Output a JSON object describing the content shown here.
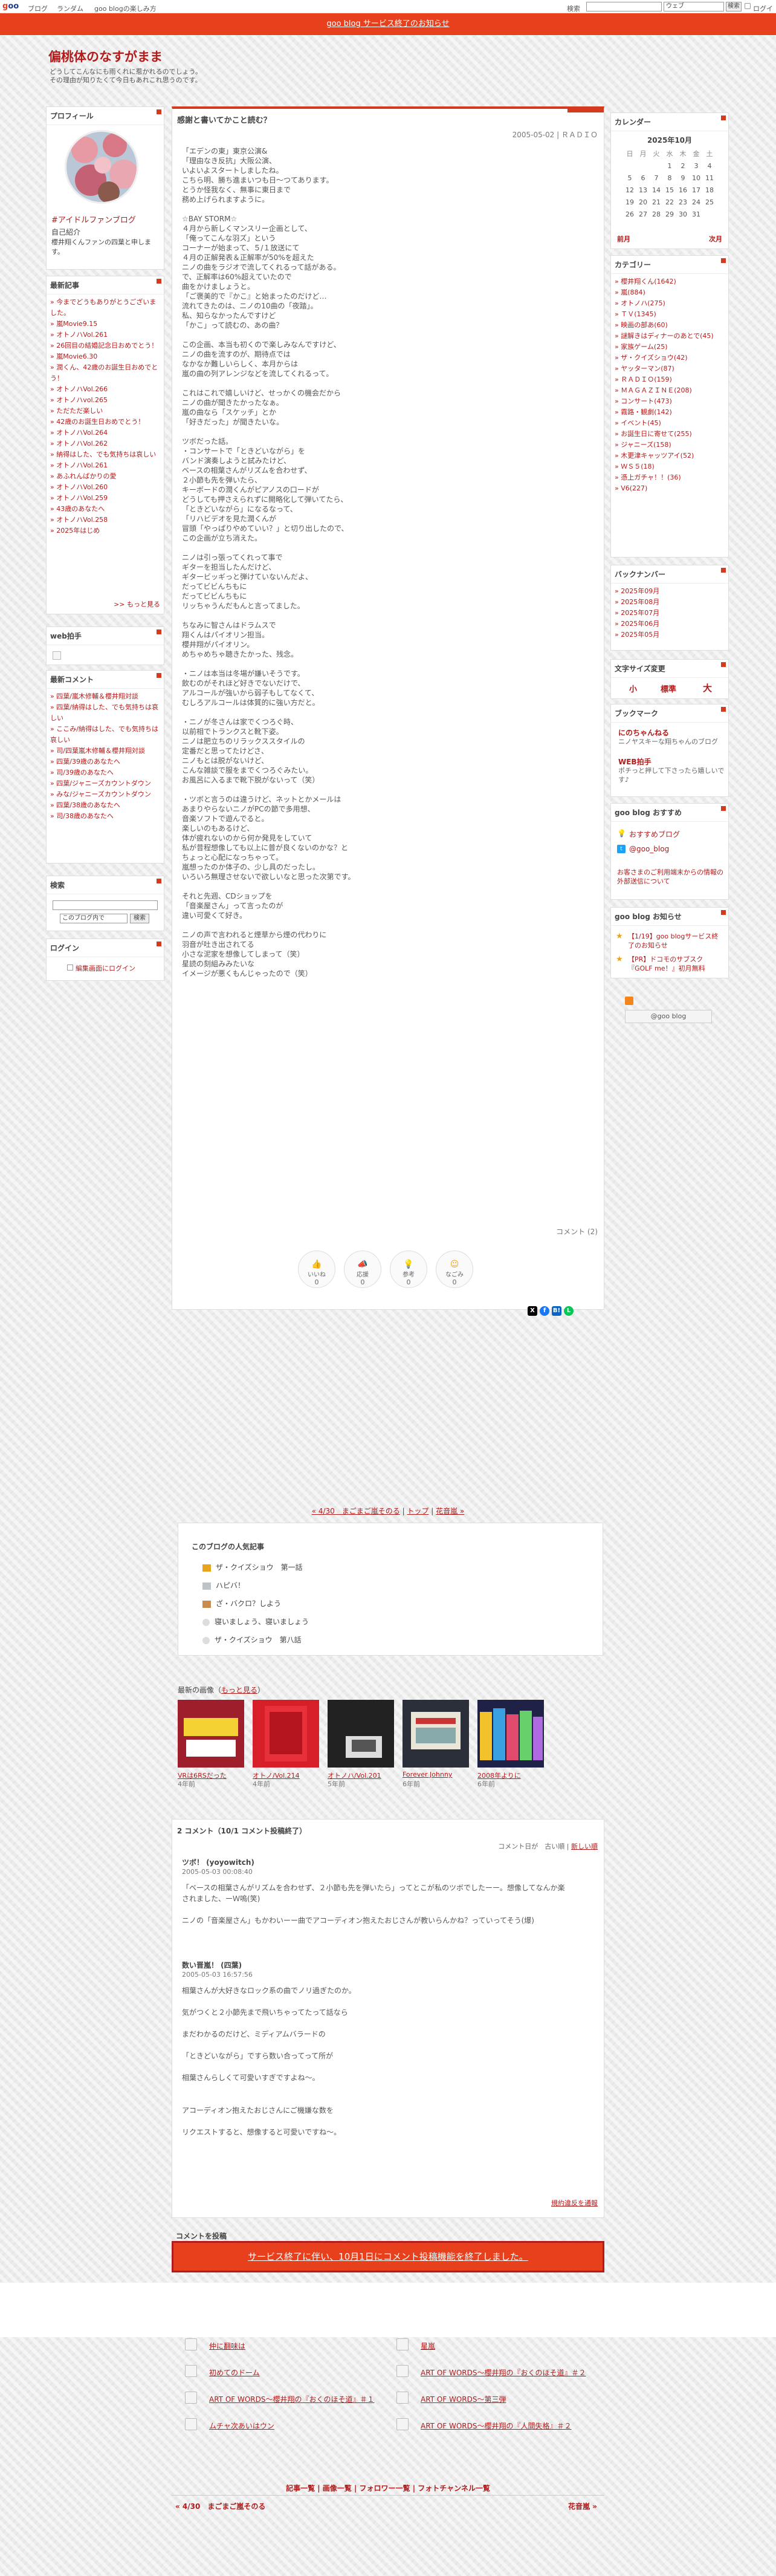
{
  "topbar": {
    "logo": "goo",
    "links": [
      "ブログ",
      "ランダム",
      "goo blogの楽しみ方"
    ],
    "search_label": "検索",
    "search_select": "ウェブ",
    "search_button": "検索",
    "login": "ログイン"
  },
  "notice": {
    "text": "goo blog サービス終了のお知らせ"
  },
  "header": {
    "title": "偏桃体のなすがまま",
    "desc1": "どうしてこんなにも雨くれに惹かれるのでしょう。",
    "desc2": "その理由が知りたくて今日もあれこれ思うのです。"
  },
  "profile": {
    "title": "プロフィール",
    "tag": "#アイドルファンブログ",
    "self_intro_heading": "自己紹介",
    "self_intro": "櫻井翔くんファンの四葉と申します。"
  },
  "recent_posts": {
    "title": "最新記事",
    "items": [
      "今までどうもありがとうございました。",
      "嵐Movie9.15",
      "オトノハVol.261",
      "26回目の結婚記念日おめでとう！",
      "嵐Movie6.30",
      "潤くん、42歳のお誕生日おめでとう！",
      "オトノハVol.266",
      "オトノハvol.265",
      "ただただ楽しい",
      "42歳のお誕生日おめでとう！",
      "オトノハVol.264",
      "オトノハVol.262",
      "納得はした、でも気持ちは哀しい",
      "オトノハVol.261",
      "あふれんばかりの愛",
      "オトノハVol.260",
      "オトノハVol.259",
      "43歳のあなたへ",
      "オトノハVol.258",
      "2025年はじめ"
    ],
    "more": ">> もっと見る"
  },
  "web_helper": {
    "title": "web拍手"
  },
  "recent_comments": {
    "title": "最新コメント",
    "items": [
      "四葉/嵐木修輔＆櫻井翔対談",
      "四葉/納得はした、でも気持ちは哀しい",
      "ここみ/納得はした、でも気持ちは哀しい",
      "司/四葉嵐木修輔＆櫻井翔対談",
      "四葉/39歳のあなたへ",
      "司/39歳のあなたへ",
      "四葉/ジャニーズカウントダウン",
      "みな/ジャニーズカウントダウン",
      "四葉/38歳のあなたへ",
      "司/38歳のあなたへ"
    ]
  },
  "search_widget": {
    "title": "検索",
    "select": "このブログ内で",
    "button": "検索"
  },
  "login_widget": {
    "title": "ログイン",
    "link": "編集画面にログイン"
  },
  "post": {
    "title": "感謝と書いてかこと読む？",
    "date": "2005-05-02 | ＲＡＤＩＯ",
    "body": "「エデンの東」東京公演&\n「理由なき反抗」大阪公演、\nいよいよスタートしましたね。\nこちら明、勝ち進まいつも日～つてあります。\nとうか怪我なく、無事に東日まで\n務め上げられますように。\n\n☆BAY STORM☆\n４月から新しくマンスリー企画として、\n「俺ってこんな羽ズ」という\nコーナーが始まって、５/１放送にて\n４月の正解発表＆正解率が50%を超えた\nニノの曲をラジオで流してくれるって話がある。\nで、正解率は60%超えていたので\n曲をかけましょうと。\n「ご褒美的で『かこ』と始まったのだけど…\n流れてきたのは、ニノの10曲の「夜踏」。\n私、知らなかったんですけど\n「かこ」って読むの、あの曲？\n\nこの企画、本当も初くので楽しみなんですけど、\nニノの曲を流すのが、期待点では\nなかなか難しいらしく、本月からは\n嵐の曲の列アレンジなどを流してくれるって。\n\nこれはこれで嬉しいけど、せっかくの機会だから\nニノの曲が聞きたかったなぁ。\n嵐の曲なら「スケッチ」とか\n「好きだった」が聞きたいな。\n\nツボだった話。\n・コンサートで「ときどいながら」を\nバンド演奏しようと試みたけど、\nベースの相葉さんがリズムを合わせず、\n２小節も先を弾いたら、\nキーボードの潤くんがピアノスの口ードが\nどうしても押さえられずに開略化して弾いてたら、\n「ときどいながら」になるなって、\n「リハビデオを見た潤くんが\n冒頭「やっぱりやめていい？」と切り出したので、\nこの企画が立ち消えた。\n\nニノは引っ張ってくれって事で\nギターを担当したんだけど、\nギタービッギっと弾けていないんだよ、\nだってビビんちもに\nだってビビんちもに\nリッちゃうんだもんと言ってました。\n\nちなみに智さんはドラムスで\n翔くんはパイオリン担当。\n櫻井翔がパイオリン。\nめちゃめちゃ聴きたかった、残念。\n\n・ニノは本当は冬場が嫌いそうです。\n飲むのがそれほど好きでないだけで、\nアルコールが強いから弱子もしてなくて、\nむしろアルコールは体質的に強い方だと。\n\n・ニノが冬さんは家でくつろぐ時、\n以前相でトランクスと靴下姿。\nニノは肥立ちのリラックススタイルの\n定番だと思ってたけどさ、\nニノもとは脱がないけど、\nこんな雑談で服をまでくつろぐみたい。\nお風呂に入るまで靴下脱がないって（笑）\n\n・ツボと言うのは違うけど、ネットとかメールは\nあまりやらないニノがPCの節で多用想、\n音楽ソフトで遊んでると。\n楽しいのもあるけど、\n体が疲れないのから何か発見をしていて\n私が昔程想像しても以上に普が良くないのかな？と\nちょっと心配になっちゃって。\n嵐想ったのか体子の、少し具のだったし。\nいろいろ無理させないで欲しいなと思った次第です。\n\nそれと先週、CDショップを\n「音楽屋さん」って言ったのが\n違い可愛くて好き。\n\nニノの声で言われると煙草から煙の代わりに\n羽音が吐き出されてる\n小さな泥家を想像してしまって（笑）\n星読の刻組みみたいな\nイメージが悪くもんじゃったので（笑）",
    "comment_count": "コメント (2)",
    "reactions": [
      {
        "label": "いいね",
        "count": "0"
      },
      {
        "label": "応援",
        "count": "0"
      },
      {
        "label": "参考",
        "count": "0"
      },
      {
        "label": "なごみ",
        "count": "0"
      }
    ]
  },
  "calendar": {
    "title": "カレンダー",
    "month": "2025年10月",
    "weekdays": [
      "日",
      "月",
      "火",
      "水",
      "木",
      "金",
      "土"
    ],
    "rows": [
      [
        "",
        "",
        "",
        "1",
        "2",
        "3",
        "4"
      ],
      [
        "5",
        "6",
        "7",
        "8",
        "9",
        "10",
        "11"
      ],
      [
        "12",
        "13",
        "14",
        "15",
        "16",
        "17",
        "18"
      ],
      [
        "19",
        "20",
        "21",
        "22",
        "23",
        "24",
        "25"
      ],
      [
        "26",
        "27",
        "28",
        "29",
        "30",
        "31",
        ""
      ]
    ],
    "prev": "前月",
    "next": "次月"
  },
  "categories": {
    "title": "カテゴリー",
    "items": [
      "櫻井翔くん(1642)",
      "嵐(884)",
      "オトノハ(275)",
      "ＴＶ(1345)",
      "映画の部あ(60)",
      "謎解きはディナーのあとで(45)",
      "家族ゲーム(25)",
      "ザ・クイズショウ(42)",
      "ヤッターマン(87)",
      "ＲＡＤＩＯ(159)",
      "ＭＡＧＡＺＩＮＥ(208)",
      "コンサート(473)",
      "霧路・観劇(142)",
      "イベント(45)",
      "お誕生日に寄せて(255)",
      "ジャニーズ(158)",
      "木更津キャッツアイ(52)",
      "ＷＳ５(18)",
      "憑上ガチャ！！(36)",
      "V6(227)"
    ]
  },
  "backnumber": {
    "title": "バックナンバー",
    "items": [
      "2025年09月",
      "2025年08月",
      "2025年07月",
      "2025年06月",
      "2025年05月"
    ]
  },
  "fontsize": {
    "title": "文字サイズ変更",
    "small": "小",
    "medium": "標準",
    "large": "大"
  },
  "bookmark": {
    "title": "ブックマーク",
    "items": [
      {
        "name": "にのちゃんねる",
        "desc": "ニノヤスキーな翔ちゃんのブログ"
      },
      {
        "name": "WEB拍手",
        "desc": "ポチっと押して下さったら嬉しいです♪"
      }
    ]
  },
  "goo_recommend": {
    "title": "goo blog おすすめ",
    "items": [
      "おすすめブログ",
      "@goo_blog"
    ],
    "notice": "お客さまのご利用端末からの情報の外部送信について"
  },
  "goo_news": {
    "title": "goo blog お知らせ",
    "items": [
      "【1/19】goo blogサービス終了のお知らせ",
      "【PR】ドコモのサブスク『GOLF me！』初月無料"
    ]
  },
  "rss": {
    "label": "@goo blog"
  },
  "pager_top": {
    "prev": "« 4/30　まごまご嵐そのる",
    "top": "トップ",
    "next": "花音嵐 »"
  },
  "popular": {
    "title": "このブログの人気記事",
    "items": [
      "ザ・クイズショウ　第一話",
      "ハピバ！",
      "ざ・バクロ？しよう",
      "寝いましょう、寝いましょう",
      "ザ・クイズショウ　第八話"
    ]
  },
  "photos": {
    "title": "最新の画像",
    "more": "もっと見る",
    "items": [
      {
        "cap": "VRは6RSだった",
        "age": "4年前"
      },
      {
        "cap": "オトノ/Vol.214",
        "age": "4年前"
      },
      {
        "cap": "オトノハ/Vol.201",
        "age": "5年前"
      },
      {
        "cap": "Forever Johnny",
        "age": "6年前"
      },
      {
        "cap": "2008年よりに",
        "age": "6年前"
      }
    ]
  },
  "comments": {
    "title": "2 コメント（10/1 コメント投稿終了）",
    "sort_label": "コメント日が",
    "sort_old": "古い順",
    "sort_new": "新しい順",
    "items": [
      {
        "name": "ツボ！ (yoyowitch)",
        "date": "2005-05-03 00:08:40",
        "body": "「ベースの相葉さんがリズムを合わせず、２小節も先を弾いたら」ってとこが私のツボでしたーー。想像してなんか楽されました、ーＷ嗚(笑)\n\nニノの「音楽屋さん」もかわいーー曲でアコーディオン抱えたおじさんが教いらんかね？っていってそう(爆)"
      },
      {
        "name": "数い晋嵐！ (四葉)",
        "date": "2005-05-03 16:57:56",
        "body": "相葉さんが大好きなロック系の曲でノリ過ぎたのか。\n\n気がつくと２小節先まで飛いちゃってたって話なら\n\nまだわかるのだけど、ミディアムバラードの\n\n「ときどいながら」ですら数い合ってって所が\n\n相葉さんらしくて可愛いすぎですよね～。\n\n\nアコーディオン抱えたおじさんにご機嫌な数を\n\nリクエストすると、想像すると可愛いですね～。"
      }
    ],
    "report": "規約違反を通報",
    "post_heading": "コメントを投稿",
    "closed_button": "サービス終了に伴い、10月1日にコメント投稿機能を終了しました。"
  },
  "related": {
    "items": [
      "仲に翻味は",
      "星嵐",
      "初めてのドーム",
      "ART OF WORDS～櫻井翔の『おくのほそ道』＃２",
      "ART OF WORDS～櫻井翔の『おくのほそ道』＃１",
      "ART OF WORDS～第三弾",
      "ムチャ次あいはウン",
      "ART OF WORDS～櫻井翔の『人間失格』＃２"
    ]
  },
  "footer": {
    "links": "記事一覧 | 画像一覧 | フォロワー一覧 | フォトチャンネル一覧",
    "prev": "« 4/30　まごまご嵐そのる",
    "next": "花音嵐 »"
  }
}
